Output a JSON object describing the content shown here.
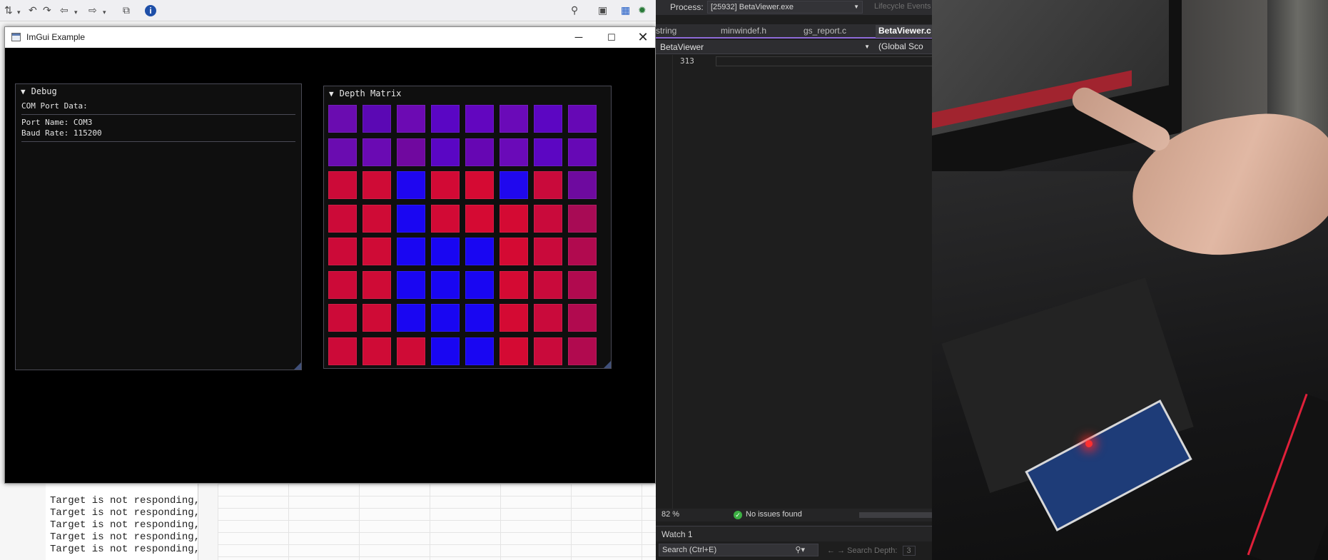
{
  "left_ide": {
    "console_lines": [
      "Target is not responding,",
      "Target is not responding,",
      "Target is not responding,",
      "Target is not responding,",
      "Target is not responding,"
    ]
  },
  "imgui_window": {
    "title": "ImGui Example",
    "debug_panel": {
      "title": "Debug",
      "label": "COM Port Data:",
      "port_name": "Port Name: COM3",
      "baud_rate": "Baud Rate: 115200"
    },
    "depth_panel": {
      "title": "Depth Matrix",
      "matrix_colors": [
        [
          "#6a0cb0",
          "#5b08b4",
          "#6c0ab3",
          "#5a06c4",
          "#6206bf",
          "#6a0ab8",
          "#5c06c2",
          "#6608b5"
        ],
        [
          "#6a0cb0",
          "#6a0ab3",
          "#70089f",
          "#5a06c4",
          "#6606b3",
          "#6a0ab8",
          "#5c06c2",
          "#6608b5"
        ],
        [
          "#cc0a38",
          "#cf0b36",
          "#1f06f0",
          "#d20a35",
          "#d50a33",
          "#2008ee",
          "#c90a3b",
          "#6e0a9f"
        ],
        [
          "#cc0a38",
          "#cf0b36",
          "#1a06f2",
          "#d20a35",
          "#d50a33",
          "#d40a33",
          "#c90a3b",
          "#a80b55"
        ],
        [
          "#cc0a38",
          "#cf0b36",
          "#1a06f2",
          "#1906f2",
          "#1906f2",
          "#d40a33",
          "#c90a3b",
          "#b10a4f"
        ],
        [
          "#cc0a38",
          "#cf0b36",
          "#1a06f2",
          "#1906f2",
          "#1906f2",
          "#d40a33",
          "#c90a3b",
          "#b10a4f"
        ],
        [
          "#cc0a38",
          "#cf0b36",
          "#1a06f2",
          "#1906f2",
          "#1906f2",
          "#d40a33",
          "#c90a3b",
          "#b10a4f"
        ],
        [
          "#cc0a38",
          "#cf0b36",
          "#cf0b36",
          "#1906f2",
          "#1906f2",
          "#d40a33",
          "#c90a3b",
          "#b10a4f"
        ]
      ]
    }
  },
  "vs_panel": {
    "process_label": "Process:",
    "process_value": "[25932] BetaViewer.exe",
    "lifecycle": "Lifecycle Events",
    "tabs": [
      "string",
      "minwindef.h",
      "gs_report.c",
      "BetaViewer.c"
    ],
    "project": "BetaViewer",
    "scope": "(Global Sco",
    "line_number": "313",
    "zoom": "82 %",
    "issues": "No issues found",
    "watch_title": "Watch 1",
    "search_placeholder": "Search (Ctrl+E)",
    "search_depth_label": "Search Depth:",
    "search_depth_value": "3"
  }
}
